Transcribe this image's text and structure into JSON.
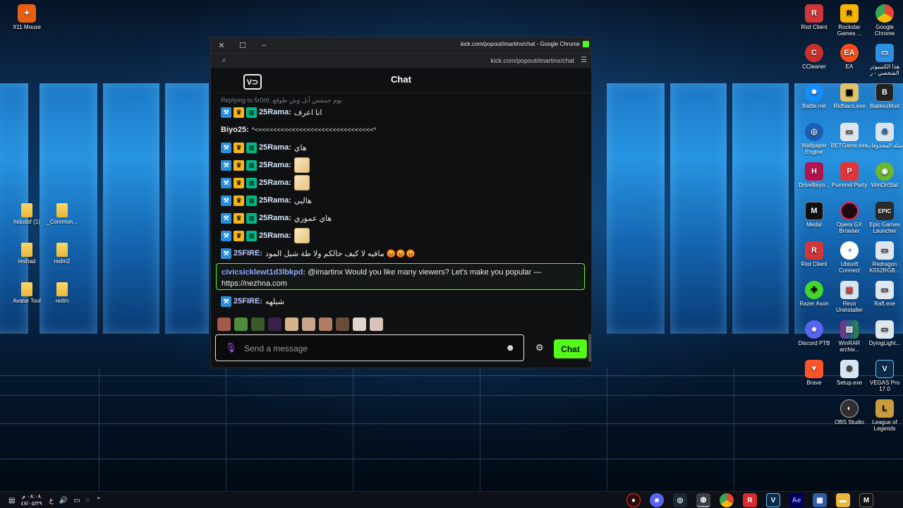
{
  "window": {
    "title": "kick.com/popout/imartinx/chat - Google Chrome",
    "url": "kick.com/popout/imartinx/chat"
  },
  "chat": {
    "title": "Chat",
    "logo_text": "V⊃",
    "reply_hint": "Replying to 5r0r6: يوم حمتتس أبل وش طوقع",
    "messages": [
      {
        "user": "25Rama:",
        "text": "انا اعرف",
        "badges": 3
      },
      {
        "user": "Biyo25:",
        "text": "^<<<<<<<<<<<<<<<<<<<<<<<<<<<<<<<<^",
        "badges": 0
      },
      {
        "user": "25Rama:",
        "text": "هاي",
        "badges": 3
      },
      {
        "user": "25Rama:",
        "text": "",
        "badges": 3,
        "emote": true
      },
      {
        "user": "25Rama:",
        "text": "",
        "badges": 3,
        "emote": true
      },
      {
        "user": "25Rama:",
        "text": "هاليي",
        "badges": 3
      },
      {
        "user": "25Rama:",
        "text": "هاي عموري",
        "badges": 3
      },
      {
        "user": "25Rama:",
        "text": "",
        "badges": 3,
        "emote": true
      },
      {
        "user": "25FIRE:",
        "text": "مافيه لا كيف حالكم ولا طة شيل المود 😡😡😡",
        "badges": 1
      }
    ],
    "highlight": {
      "user": "civicsicklewt1d3lbkpd:",
      "text": "@imartinx Would you like many viewers? Let's make you popular — https://nezhna.com"
    },
    "last_message": {
      "user": "25FIRE:",
      "text": "شيلهه"
    },
    "input_placeholder": "Send a message",
    "send_label": "Chat"
  },
  "desktop_icons_left": [
    {
      "label": "X11 Mouse"
    },
    {
      "label": "hidusbf (1)"
    },
    {
      "label": "_Common..."
    },
    {
      "label": "reshad"
    },
    {
      "label": "redm2"
    },
    {
      "label": "Avatar Tool"
    },
    {
      "label": "redm"
    }
  ],
  "desktop_icons_right": [
    {
      "label": "Riot Client"
    },
    {
      "label": "Rockstar Games ..."
    },
    {
      "label": "Google Chrome"
    },
    {
      "label": "CCleaner"
    },
    {
      "label": "EA"
    },
    {
      "label": "هذا الكمبيوتر الشخصي - ر"
    },
    {
      "label": "Battle.net"
    },
    {
      "label": "RidNacs.exe"
    },
    {
      "label": "BakkesMod"
    },
    {
      "label": "Wallpaper Engine"
    },
    {
      "label": "BETGame.exe"
    },
    {
      "label": "سلة المحذوفات"
    },
    {
      "label": "DriveBeyo..."
    },
    {
      "label": "Pummel Party"
    },
    {
      "label": "WinDirStat"
    },
    {
      "label": "Medal"
    },
    {
      "label": "Opera GX Browser"
    },
    {
      "label": "Epic Games Launcher"
    },
    {
      "label": "Riot Client"
    },
    {
      "label": "Ubisoft Connect"
    },
    {
      "label": "Redragon K552RGB..."
    },
    {
      "label": "Razer Axon"
    },
    {
      "label": "Revo Uninstaller"
    },
    {
      "label": "Raft.exe"
    },
    {
      "label": "Discord PTB"
    },
    {
      "label": "WinRAR archiv..."
    },
    {
      "label": "DyingLight..."
    },
    {
      "label": "Brave"
    },
    {
      "label": "Setup.exe"
    },
    {
      "label": "VEGAS Pro 17.0"
    },
    {
      "label": "OBS Studio"
    },
    {
      "label": "League of Legends"
    }
  ],
  "taskbar": {
    "time": "٠٨:٠٨ م",
    "date": "٤٧/٠٥/٢٩",
    "lang": "ع"
  }
}
